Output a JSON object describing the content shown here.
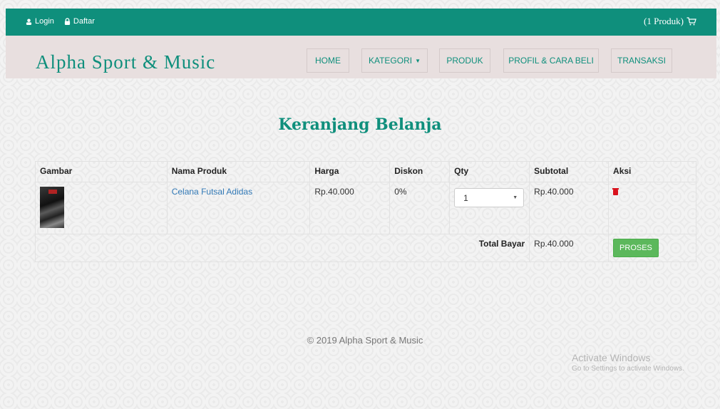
{
  "topbar": {
    "login_label": "Login",
    "register_label": "Daftar",
    "cart_summary": "(1 Produk)",
    "color": "#0f8f7c"
  },
  "brand": "Alpha Sport & Music",
  "nav": {
    "home": "HOME",
    "kategori": "KATEGORI",
    "produk": "PRODUK",
    "profil": "PROFIL & CARA BELI",
    "transaksi": "TRANSAKSI"
  },
  "page_title": "Keranjang Belanja",
  "cart": {
    "headers": [
      "Gambar",
      "Nama Produk",
      "Harga",
      "Diskon",
      "Qty",
      "Subtotal",
      "Aksi"
    ],
    "rows": [
      {
        "name": "Celana Futsal Adidas",
        "price": "Rp.40.000",
        "discount": "0%",
        "qty": "1",
        "subtotal": "Rp.40.000"
      }
    ],
    "total_label": "Total Bayar",
    "total_value": "Rp.40.000",
    "process_label": "PROSES"
  },
  "footer": "© 2019 Alpha Sport & Music",
  "watermark": {
    "title": "Activate Windows",
    "subtitle": "Go to Settings to activate Windows."
  }
}
